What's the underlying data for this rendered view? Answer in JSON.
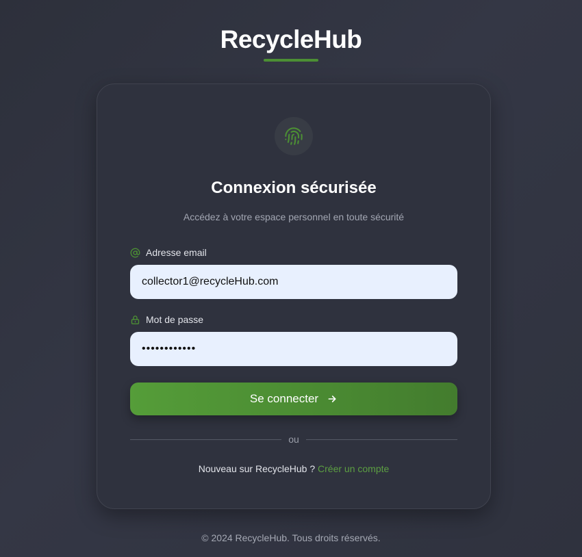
{
  "brand": {
    "title": "RecycleHub"
  },
  "colors": {
    "accent": "#4c8f34",
    "link": "#5c9f42",
    "input_bg": "#e8f0fe"
  },
  "card": {
    "icon": "fingerprint-icon",
    "title": "Connexion sécurisée",
    "subtitle": "Accédez à votre espace personnel en toute sécurité"
  },
  "form": {
    "email": {
      "label": "Adresse email",
      "icon": "at-icon",
      "value": "collector1@recycleHub.com"
    },
    "password": {
      "label": "Mot de passe",
      "icon": "lock-icon",
      "value": "••••••••••••"
    },
    "submit_label": "Se connecter",
    "submit_icon": "arrow-right-icon"
  },
  "divider": {
    "text": "ou"
  },
  "signup": {
    "prompt": "Nouveau sur RecycleHub ?",
    "link": "Créer un compte"
  },
  "footer": {
    "text": "© 2024 RecycleHub. Tous droits réservés."
  }
}
